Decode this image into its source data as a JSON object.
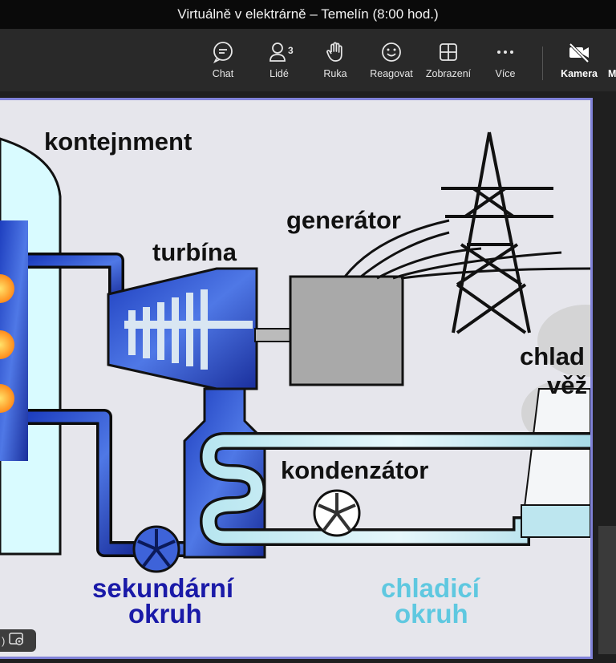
{
  "window": {
    "title": "Virtuálně v elektrárně – Temelín (8:00 hod.)"
  },
  "toolbar": {
    "chat": {
      "label": "Chat",
      "icon": "chat-bubble-icon"
    },
    "people": {
      "label": "Lidé",
      "count": "3",
      "icon": "people-icon"
    },
    "raise_hand": {
      "label": "Ruka",
      "icon": "hand-icon"
    },
    "react": {
      "label": "Reagovat",
      "icon": "smiley-icon"
    },
    "view": {
      "label": "Zobrazení",
      "icon": "grid-icon"
    },
    "more": {
      "label": "Více",
      "icon": "more-dots-icon"
    },
    "camera": {
      "label": "Kamera",
      "icon": "camera-off-icon"
    },
    "mic_partial": {
      "label": "M"
    }
  },
  "diagram": {
    "containment": "kontejnment",
    "turbine": "turbína",
    "generator": "generátor",
    "cooling_tower_1": "chlad",
    "cooling_tower_2": "věž",
    "condenser": "kondenzátor",
    "secondary_1": "sekundární",
    "secondary_2": "okruh",
    "cooling_circuit_1": "chladicí",
    "cooling_circuit_2": "okruh"
  },
  "stage_controls": {
    "partial_label": ")"
  },
  "colors": {
    "accent_frame": "#8082d8",
    "secondary_label": "#1a1aa8",
    "cooling_label": "#5fc8e0",
    "pipe_blue": "#2a49c8"
  }
}
